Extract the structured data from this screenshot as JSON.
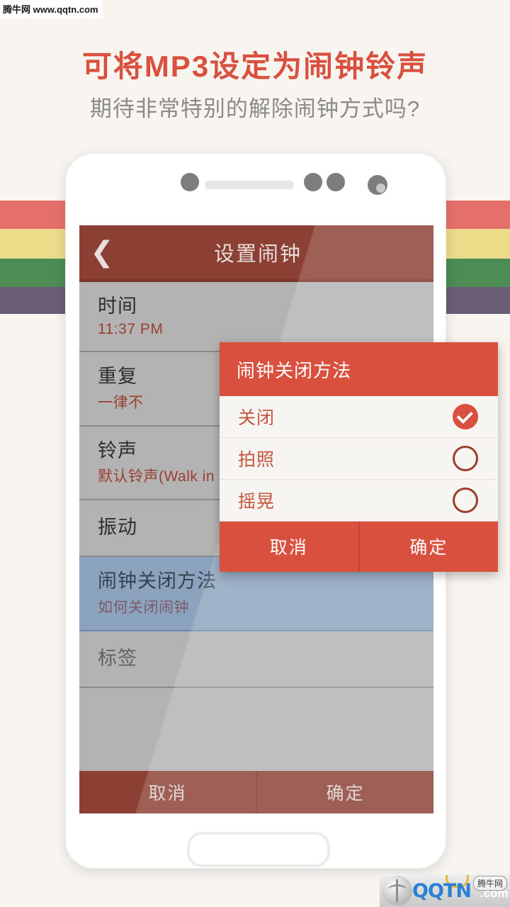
{
  "watermark": {
    "top_left": "腾牛网 www.qqtn.com",
    "bottom_brand": "QQTN",
    "bottom_tld": ".com",
    "bottom_badge": "腾牛网"
  },
  "promo": {
    "headline": "可将MP3设定为闹钟铃声",
    "subhead": "期待非常特别的解除闹钟方式吗?",
    "bands": [
      "#e5706b",
      "#ecdc8a",
      "#4c8d55",
      "#6b5c76"
    ],
    "headline_color": "#d9503f",
    "subhead_color": "#8a8a8a"
  },
  "app": {
    "appbar": {
      "back_icon": "chevron-left-icon",
      "title": "设置闹钟"
    },
    "rows": [
      {
        "title": "时间",
        "value": "11:37 PM"
      },
      {
        "title": "重复",
        "value": "一律不"
      },
      {
        "title": "铃声",
        "value": "默认铃声(Walk in th"
      },
      {
        "title": "振动",
        "value": ""
      },
      {
        "title": "闹钟关闭方法",
        "value": "如何关闭闹钟"
      },
      {
        "title": "标签",
        "value": ""
      }
    ],
    "bottom_bar": {
      "cancel": "取消",
      "confirm": "确定"
    }
  },
  "dialog": {
    "title": "闹钟关闭方法",
    "options": [
      {
        "label": "关闭",
        "selected": true
      },
      {
        "label": "拍照",
        "selected": false
      },
      {
        "label": "摇晃",
        "selected": false
      }
    ],
    "cancel": "取消",
    "confirm": "确定",
    "accent": "#d9503f"
  }
}
